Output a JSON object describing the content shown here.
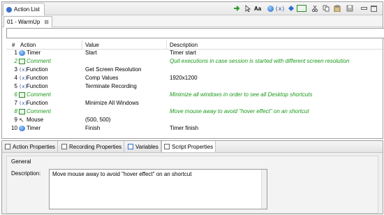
{
  "view": {
    "title": "Action List"
  },
  "toolbar_icons": [
    "run-icon",
    "pointer-icon",
    "text-aa-icon",
    "record-icon",
    "function-icon",
    "diamond-icon",
    "comment-icon",
    "cut-icon",
    "copy-icon",
    "paste-icon",
    "disk-icon"
  ],
  "editor": {
    "tab_title": "01 - WarmUp",
    "close": "⊠"
  },
  "filter": {
    "value": ""
  },
  "table": {
    "headers": {
      "num": "#",
      "action": "Action",
      "value": "Value",
      "description": "Description"
    },
    "rows": [
      {
        "num": "1",
        "type": "timer",
        "action": "Timer",
        "value": "Start",
        "description": "Timer start"
      },
      {
        "num": "2",
        "type": "comment",
        "action": "Comment",
        "value": "",
        "description": "Quit executions in case session is started with different screen resolution"
      },
      {
        "num": "3",
        "type": "function",
        "action": "Function",
        "value": "Get Screen Resolution",
        "description": ""
      },
      {
        "num": "4",
        "type": "function",
        "action": "Function",
        "value": "Comp Values",
        "description": "1920x1200"
      },
      {
        "num": "5",
        "type": "function",
        "action": "Function",
        "value": "Terminate Recording",
        "description": ""
      },
      {
        "num": "6",
        "type": "comment",
        "action": "Comment",
        "value": "",
        "description": "Minimize all windows in order to see all Desktop shortcuts"
      },
      {
        "num": "7",
        "type": "function",
        "action": "Function",
        "value": "Minimize All Windows",
        "description": ""
      },
      {
        "num": "8",
        "type": "comment",
        "action": "Comment",
        "value": "",
        "description": "Move mouse away to avoid \"hover effect\" on an shortcut"
      },
      {
        "num": "9",
        "type": "mouse",
        "action": "Mouse",
        "value": "(500, 500)",
        "description": ""
      },
      {
        "num": "10",
        "type": "timer",
        "action": "Timer",
        "value": "Finish",
        "description": "Timer finish"
      }
    ]
  },
  "bottom_tabs": [
    {
      "label": "Action Properties"
    },
    {
      "label": "Recording Properties"
    },
    {
      "label": "Variables"
    },
    {
      "label": "Script Properties"
    }
  ],
  "properties": {
    "group_title": "General",
    "description_label": "Description:",
    "description_value": "Move mouse away to avoid \"hover effect\" on an shortcut"
  },
  "colors": {
    "comment": "#1a9a1a",
    "accent": "#1c5fc7"
  }
}
